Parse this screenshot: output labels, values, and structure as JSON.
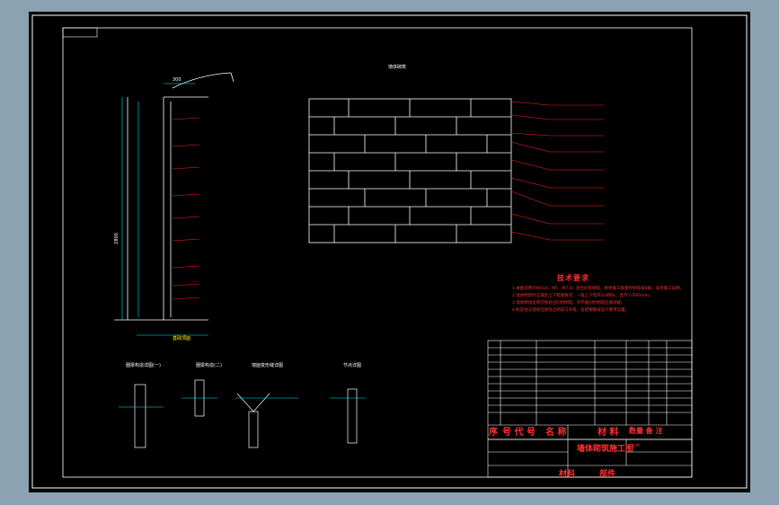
{
  "drawing": {
    "brick_wall_title": "墙体砌筑",
    "detail_titles": [
      "圈梁构造详图(一)",
      "圈梁构造(二)",
      "墙面变形缝详图",
      "节点详图"
    ],
    "tech_notes_title": "技术要求",
    "tech_notes": [
      "1.本图适用于MU10、M5（M7.5）混合砂浆砌筑，砌体施工质量控制等级B级，详见施工说明。",
      "2.墙体砌筑时应满足上下错缝要求，一般上下错开1/4砖长，且不小于60mm。",
      "3.墙体转角处和交接处应同时砌筑，对不能同时砌筑应留斜槎。",
      "4.构造柱与墙体连接处应砌成马牙槎，拉结钢筋按设计要求设置。"
    ],
    "bom_header": {
      "seq": "序",
      "code": "号 代 号",
      "name": "名  称",
      "material": "材 料",
      "qty": "数量 备 注"
    },
    "title_block": {
      "drawing_name": "墙体砌筑施工图",
      "scale_label": "比例",
      "material_label": "材料",
      "part_label": "部件"
    },
    "dim_height": "2800",
    "dim_top": "300",
    "bottom_label": "基础顶面"
  }
}
